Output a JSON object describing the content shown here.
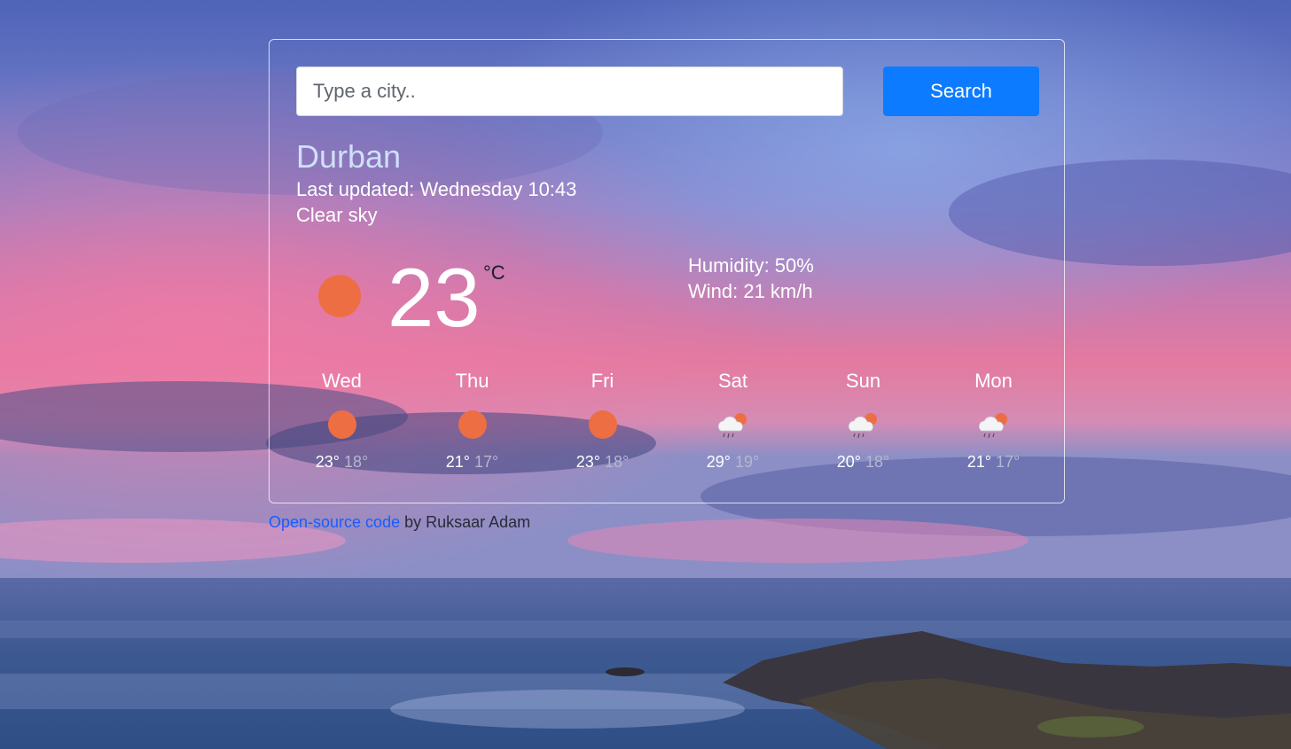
{
  "search": {
    "placeholder": "Type a city..",
    "button_label": "Search"
  },
  "current": {
    "city": "Durban",
    "last_updated": "Last updated: Wednesday 10:43",
    "description": "Clear sky",
    "temperature": "23",
    "unit": "°C",
    "icon": "sun-icon",
    "humidity": "Humidity: 50%",
    "wind": "Wind: 21 km/h"
  },
  "forecast": [
    {
      "day": "Wed",
      "icon": "sun-icon",
      "max": "23°",
      "min": "18°"
    },
    {
      "day": "Thu",
      "icon": "sun-icon",
      "max": "21°",
      "min": "17°"
    },
    {
      "day": "Fri",
      "icon": "sun-icon",
      "max": "23°",
      "min": "18°"
    },
    {
      "day": "Sat",
      "icon": "rain-cloud-icon",
      "max": "29°",
      "min": "19°"
    },
    {
      "day": "Sun",
      "icon": "rain-cloud-icon",
      "max": "20°",
      "min": "18°"
    },
    {
      "day": "Mon",
      "icon": "rain-cloud-icon",
      "max": "21°",
      "min": "17°"
    }
  ],
  "footer": {
    "link_text": "Open-source code",
    "suffix": " by Ruksaar Adam"
  },
  "colors": {
    "accent": "#0d7bff",
    "sun": "#ee6e43",
    "city_text": "#cfe0f8"
  }
}
